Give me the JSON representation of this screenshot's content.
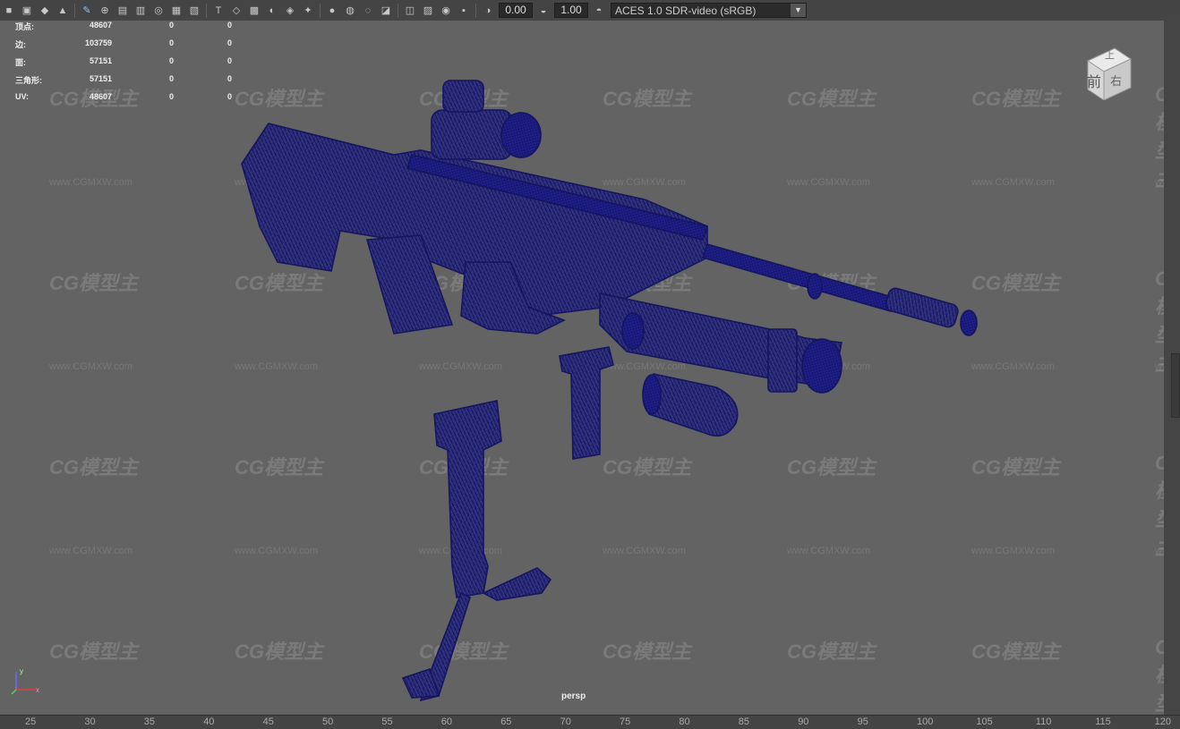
{
  "toolbar": {
    "exposure_value": "0.00",
    "gamma_value": "1.00",
    "color_space": "ACES 1.0 SDR-video (sRGB)",
    "icons": [
      "camera-select-icon",
      "camera-attributes-icon",
      "bookmark-icon",
      "image-plane-icon",
      "grid-icon",
      "film-gate-icon",
      "resolution-gate-icon",
      "gate-mask-icon",
      "field-chart-icon",
      "safe-action-icon",
      "safe-title-icon",
      "wireframe-icon",
      "smooth-shade-icon",
      "default-material-icon",
      "textured-icon",
      "use-all-lights-icon",
      "shadows-icon",
      "ambient-occlusion-icon",
      "motion-blur-icon",
      "anti-aliasing-icon",
      "depth-of-field-icon",
      "isolate-select-icon",
      "xray-icon",
      "xray-joints-icon",
      "backface-icon",
      "exposure-icon",
      "gamma-icon",
      "color-management-icon"
    ]
  },
  "heads_up": {
    "rows": [
      {
        "label": "顶点:",
        "value": "48607",
        "sel": "0",
        "comp": "0"
      },
      {
        "label": "边:",
        "value": "103759",
        "sel": "0",
        "comp": "0"
      },
      {
        "label": "面:",
        "value": "57151",
        "sel": "0",
        "comp": "0"
      },
      {
        "label": "三角形:",
        "value": "57151",
        "sel": "0",
        "comp": "0"
      },
      {
        "label": "UV:",
        "value": "48607",
        "sel": "0",
        "comp": "0"
      }
    ]
  },
  "view_cube": {
    "top": "上",
    "front": "前",
    "right": "右"
  },
  "camera_label": "persp",
  "watermark": {
    "logo_text": "CG模型主",
    "url_text": "www.CGMXW.com"
  },
  "timeline": {
    "ticks": [
      "25",
      "30",
      "35",
      "40",
      "45",
      "50",
      "55",
      "60",
      "65",
      "70",
      "75",
      "80",
      "85",
      "90",
      "95",
      "100",
      "105",
      "110",
      "115",
      "120"
    ]
  },
  "colors": {
    "wireframe": "#1a1a7a",
    "viewport_bg": "#636363",
    "ui_bg": "#444444"
  }
}
